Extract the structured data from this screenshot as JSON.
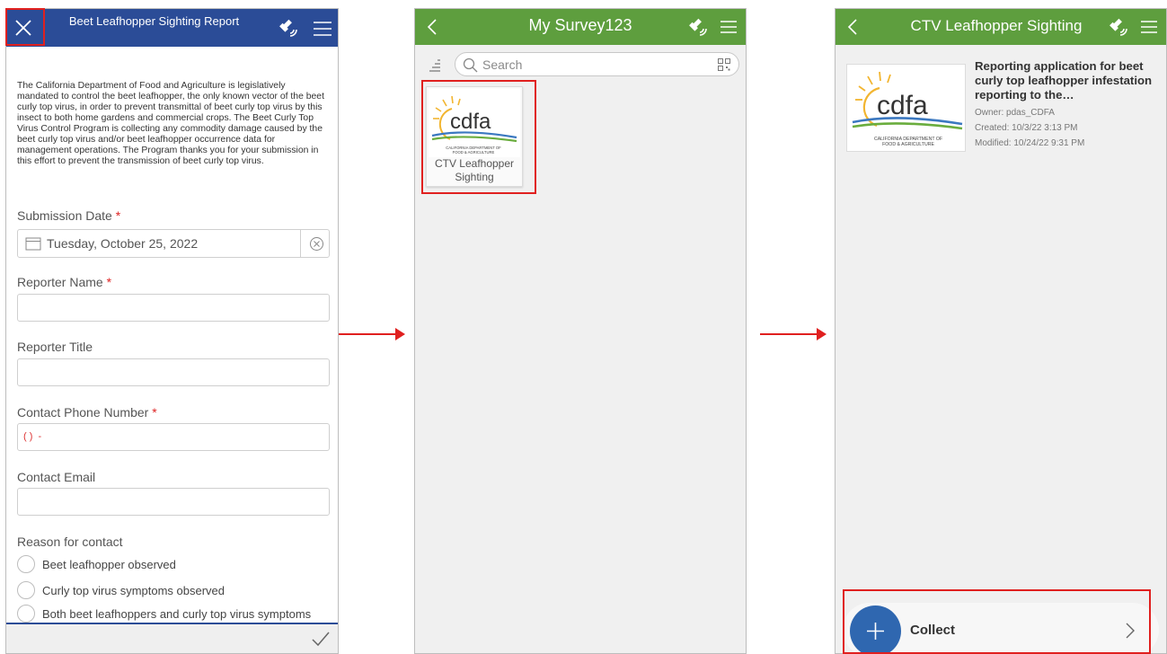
{
  "screen1": {
    "header": {
      "title": "Beet Leafhopper Sighting Report",
      "close_icon": "close-icon",
      "satellite_icon": "satellite-icon",
      "menu_icon": "menu-icon"
    },
    "intro": "The California Department of Food and Agriculture is legislatively mandated to control the beet leafhopper, the only known vector of the beet curly top virus, in order to prevent transmittal of beet curly top virus by this insect to both home gardens and commercial crops. The Beet Curly Top Virus Control Program is collecting any commodity damage caused by the beet curly top virus and/or beet leafhopper occurrence data for management operations. The Program thanks you for your submission in this effort to prevent the transmission of beet curly top virus.",
    "questions": {
      "submission_date": {
        "label": "Submission Date",
        "required_mark": "*",
        "value": "Tuesday, October 25, 2022"
      },
      "reporter_name": {
        "label": "Reporter Name",
        "required_mark": "*"
      },
      "reporter_title": {
        "label": "Reporter Title"
      },
      "contact_phone": {
        "label": "Contact Phone Number",
        "required_mark": "*",
        "placeholder": "( )  -"
      },
      "contact_email": {
        "label": "Contact Email"
      },
      "reason": {
        "label": "Reason for contact",
        "options": [
          "Beet leafhopper observed",
          "Curly top virus symptoms observed",
          "Both beet leafhoppers and curly top virus symptoms"
        ]
      }
    },
    "footer": {
      "submit_icon": "check-icon"
    }
  },
  "screen2": {
    "header": {
      "title": "My Survey123"
    },
    "search": {
      "placeholder": "Search"
    },
    "survey_tile": {
      "label": "CTV Leafhopper Sighting",
      "logo_text": "cdfa",
      "logo_caption": "CALIFORNIA DEPARTMENT OF FOOD & AGRICULTURE"
    }
  },
  "screen3": {
    "header": {
      "title": "CTV Leafhopper Sighting"
    },
    "thumb": {
      "logo_text": "cdfa",
      "logo_caption": "CALIFORNIA DEPARTMENT OF FOOD & AGRICULTURE"
    },
    "description": "Reporting application for beet curly top leafhopper infestation reporting to the…",
    "owner": "Owner: pdas_CDFA",
    "created": "Created: 10/3/22 3:13 PM",
    "modified": "Modified: 10/24/22 9:31 PM",
    "collect": {
      "label": "Collect"
    }
  },
  "colors": {
    "survey_header_blue": "#2b4c97",
    "app_header_green": "#5e9e3e",
    "highlight_red": "#e0201f",
    "collect_blue": "#2f67b0"
  }
}
